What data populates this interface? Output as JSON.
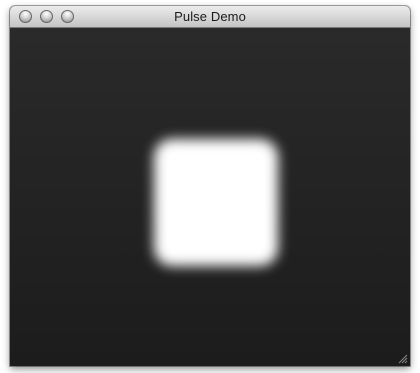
{
  "window": {
    "title": "Pulse Demo"
  },
  "controls": {
    "close": "close-icon",
    "minimize": "minimize-icon",
    "zoom": "zoom-icon"
  },
  "content": {
    "background_color": "#1e1e1e",
    "pulse_color": "#ffffff"
  }
}
